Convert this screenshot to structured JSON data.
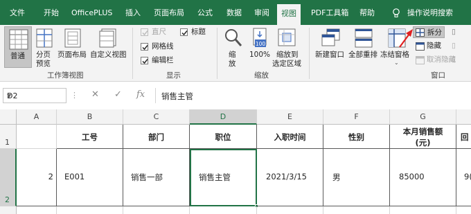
{
  "menu": {
    "tabs": [
      {
        "label": "文件"
      },
      {
        "label": "开始"
      },
      {
        "label": "OfficePLUS"
      },
      {
        "label": "插入"
      },
      {
        "label": "页面布局"
      },
      {
        "label": "公式"
      },
      {
        "label": "数据"
      },
      {
        "label": "审阅"
      },
      {
        "label": "视图"
      },
      {
        "label": "PDF工具箱"
      },
      {
        "label": "帮助"
      }
    ],
    "active_tab": "视图",
    "tell_me": "操作说明搜索"
  },
  "ribbon": {
    "workbook_views": {
      "group_label": "工作簿视图",
      "normal": "普通",
      "page_break_line1": "分页",
      "page_break_line2": "预览",
      "page_layout": "页面布局",
      "custom_views": "自定义视图"
    },
    "show": {
      "group_label": "显示",
      "ruler": "直尺",
      "gridlines": "网格线",
      "formula_bar": "编辑栏",
      "headings": "标题"
    },
    "zoom": {
      "group_label": "缩放",
      "zoom_line1": "缩",
      "zoom_line2": "放",
      "hundred": "100%",
      "hundred_icon_text": "100",
      "zoom_to_selection_line1": "缩放到",
      "zoom_to_selection_line2": "选定区域"
    },
    "window": {
      "group_label": "窗口",
      "new_window": "新建窗口",
      "arrange_all": "全部重排",
      "freeze_panes": "冻结窗格",
      "split": "拆分",
      "hide": "隐藏",
      "unhide": "取消隐藏"
    }
  },
  "formula_bar": {
    "name_box": "D2",
    "fx": "fx",
    "cancel": "✕",
    "enter": "✓",
    "content": "销售主管"
  },
  "sheet": {
    "columns": [
      "A",
      "B",
      "C",
      "D",
      "E",
      "F",
      "G"
    ],
    "rows": [
      "1",
      "2"
    ],
    "header_row": [
      "工号",
      "部门",
      "职位",
      "入职时间",
      "性别"
    ],
    "header_g_line1": "本月销售额",
    "header_g_line2": "(元)",
    "header_h_partial": "回",
    "data_row": {
      "a": "2",
      "b": "E001",
      "c": "销售一部",
      "d": "销售主管",
      "e": "2021/3/15",
      "f": "男",
      "g": "85000",
      "h_partial": "9("
    },
    "active_cell": "D2"
  }
}
